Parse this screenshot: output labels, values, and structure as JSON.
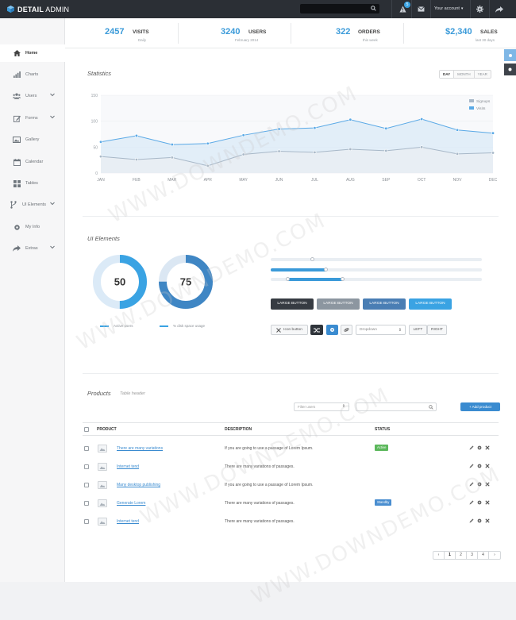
{
  "app": {
    "logo_bold": "DETAIL",
    "logo_thin": " ADMIN"
  },
  "topbar": {
    "notifications_count": "5",
    "account_label": "Your account",
    "icons": [
      "alert-icon",
      "mail-icon",
      "gear-icon",
      "share-icon"
    ]
  },
  "sidebar": {
    "items": [
      {
        "label": "Home",
        "icon": "home-icon",
        "has_submenu": false,
        "active": true
      },
      {
        "label": "Charts",
        "icon": "bar-chart-icon",
        "has_submenu": false
      },
      {
        "label": "Users",
        "icon": "users-icon",
        "has_submenu": true
      },
      {
        "label": "Forms",
        "icon": "edit-icon",
        "has_submenu": true
      },
      {
        "label": "Gallery",
        "icon": "picture-icon",
        "has_submenu": false
      },
      {
        "label": "Calendar",
        "icon": "calendar-icon",
        "has_submenu": false
      },
      {
        "label": "Tables",
        "icon": "grid-icon",
        "has_submenu": false
      },
      {
        "label": "UI Elements",
        "icon": "code-fork-icon",
        "has_submenu": true
      },
      {
        "label": "My Info",
        "icon": "cog-icon",
        "has_submenu": false
      },
      {
        "label": "Extras",
        "icon": "share-icon",
        "has_submenu": true
      }
    ]
  },
  "stats": [
    {
      "value": "2457",
      "label": "VISITS",
      "sub": "Daily"
    },
    {
      "value": "3240",
      "label": "USERS",
      "sub": "February 2014"
    },
    {
      "value": "322",
      "label": "ORDERS",
      "sub": "this week"
    },
    {
      "value": "$2,340",
      "label": "SALES",
      "sub": "last 30 days"
    }
  ],
  "statistics": {
    "title": "Statistics",
    "range_options": [
      "DAY",
      "MONTH",
      "YEAR"
    ],
    "selected_range": "DAY"
  },
  "chart_data": {
    "type": "area",
    "categories": [
      "JAN",
      "FEB",
      "MAR",
      "APR",
      "MAY",
      "JUN",
      "JUL",
      "AUG",
      "SEP",
      "OCT",
      "NOV",
      "DEC"
    ],
    "series": [
      {
        "name": "Signups",
        "values": [
          32,
          26,
          30,
          14,
          36,
          42,
          40,
          46,
          43,
          50,
          37,
          39
        ]
      },
      {
        "name": "Visits",
        "values": [
          60,
          72,
          55,
          57,
          73,
          85,
          87,
          103,
          86,
          104,
          83,
          77
        ]
      }
    ],
    "yticks": [
      0,
      50,
      100,
      150
    ],
    "ylim": [
      0,
      150
    ],
    "grid": true,
    "legend_position": "top-right",
    "colors": {
      "Signups": "#a8b8c8",
      "Visits": "#5aa9e6"
    }
  },
  "ui_elements": {
    "title": "UI Elements",
    "donuts": [
      {
        "value": 50,
        "label": "50",
        "legend": "Active users",
        "color": "#3aa3e3",
        "track": "#dbeaf7"
      },
      {
        "value": 75,
        "label": "75",
        "legend": "% disk space usage",
        "color": "#3f86c4",
        "track": "#dbe7f3"
      }
    ],
    "sliders": [
      {
        "fill": 0.19
      },
      {
        "fill": 0.26
      },
      {
        "start": 0.08,
        "end": 0.34
      }
    ],
    "large_buttons": [
      {
        "label": "LARGE BUTTON",
        "color": "#363b42"
      },
      {
        "label": "LARGE BUTTON",
        "color": "#8c96a0"
      },
      {
        "label": "LARGE BUTTON",
        "color": "#4a7eb4"
      },
      {
        "label": "LARGE BUTTON",
        "color": "#3aa3e3"
      }
    ],
    "icon_button_label": "Icon button",
    "dropdown_label": "Dropdown",
    "left_label": "LEFT",
    "right_label": "RIGHT"
  },
  "products": {
    "title": "Products",
    "subtitle": "Table header",
    "filter_placeholder": "Filter users",
    "add_label": "+ Add product",
    "columns": [
      "PRODUCT",
      "DESCRIPTION",
      "STATUS"
    ],
    "rows": [
      {
        "name": "There are many variations",
        "description": "If you are going to use a passage of Lorem Ipsum.",
        "status": "Active",
        "status_color": "#5cb85c"
      },
      {
        "name": "Internet tend",
        "description": "There are many variations of passages.",
        "status": ""
      },
      {
        "name": "Many desktop publishing",
        "description": "If you are going to use a passage of Lorem Ipsum.",
        "status": ""
      },
      {
        "name": "Generate Lorem",
        "description": "There are many variations of passages.",
        "status": "Standby",
        "status_color": "#4a8ed0"
      },
      {
        "name": "Internet tend",
        "description": "There are many variations of passages.",
        "status": ""
      }
    ],
    "pagination": [
      "‹",
      "1",
      "2",
      "3",
      "4",
      "›"
    ],
    "current_page": "1"
  },
  "watermark_text": "WWW.DOWNDEMO.COM"
}
